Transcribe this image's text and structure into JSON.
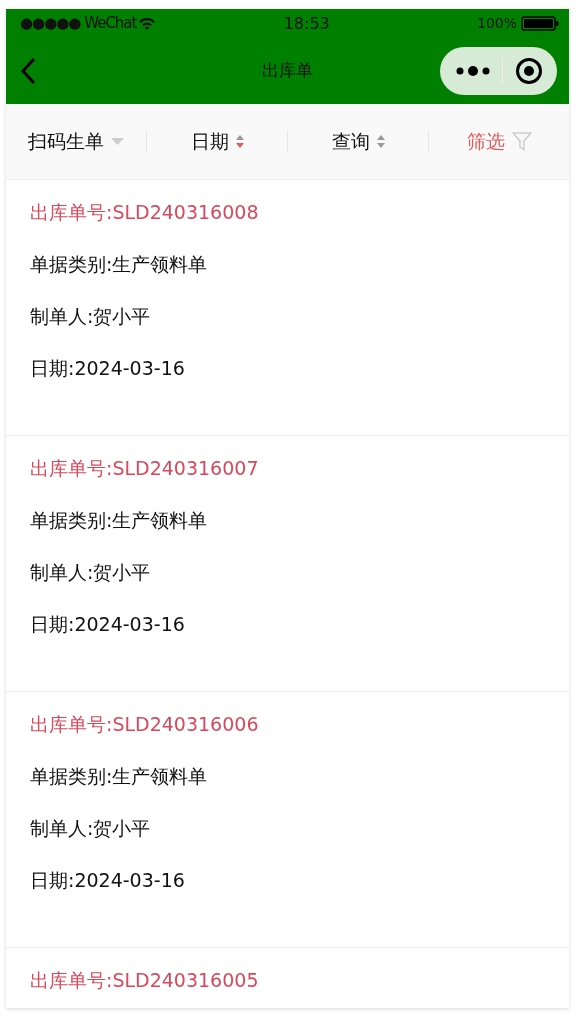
{
  "status_bar": {
    "carrier": "●●●●● WeChat",
    "time": "18:53",
    "battery": "100%"
  },
  "nav_bar": {
    "title": "出库单"
  },
  "filter_tabs": [
    {
      "label": "扫码生单",
      "kind": "dropdown",
      "selected": false
    },
    {
      "label": "日期",
      "kind": "sort",
      "descending": true,
      "selected": false
    },
    {
      "label": "查询",
      "kind": "sort",
      "descending": false,
      "selected": false
    },
    {
      "label": "筛选",
      "kind": "filter",
      "selected": true
    }
  ],
  "orders": [
    {
      "number": "出库单号:SLD240316008",
      "lines": [
        "单据类别:生产领料单",
        "制单人:贺小平",
        "日期:2024-03-16"
      ]
    },
    {
      "number": "出库单号:SLD240316007",
      "lines": [
        "单据类别:生产领料单",
        "制单人:贺小平",
        "日期:2024-03-16"
      ]
    },
    {
      "number": "出库单号:SLD240316006",
      "lines": [
        "单据类别:生产领料单",
        "制单人:贺小平",
        "日期:2024-03-16"
      ]
    },
    {
      "number": "出库单号:SLD240316005"
    }
  ]
}
